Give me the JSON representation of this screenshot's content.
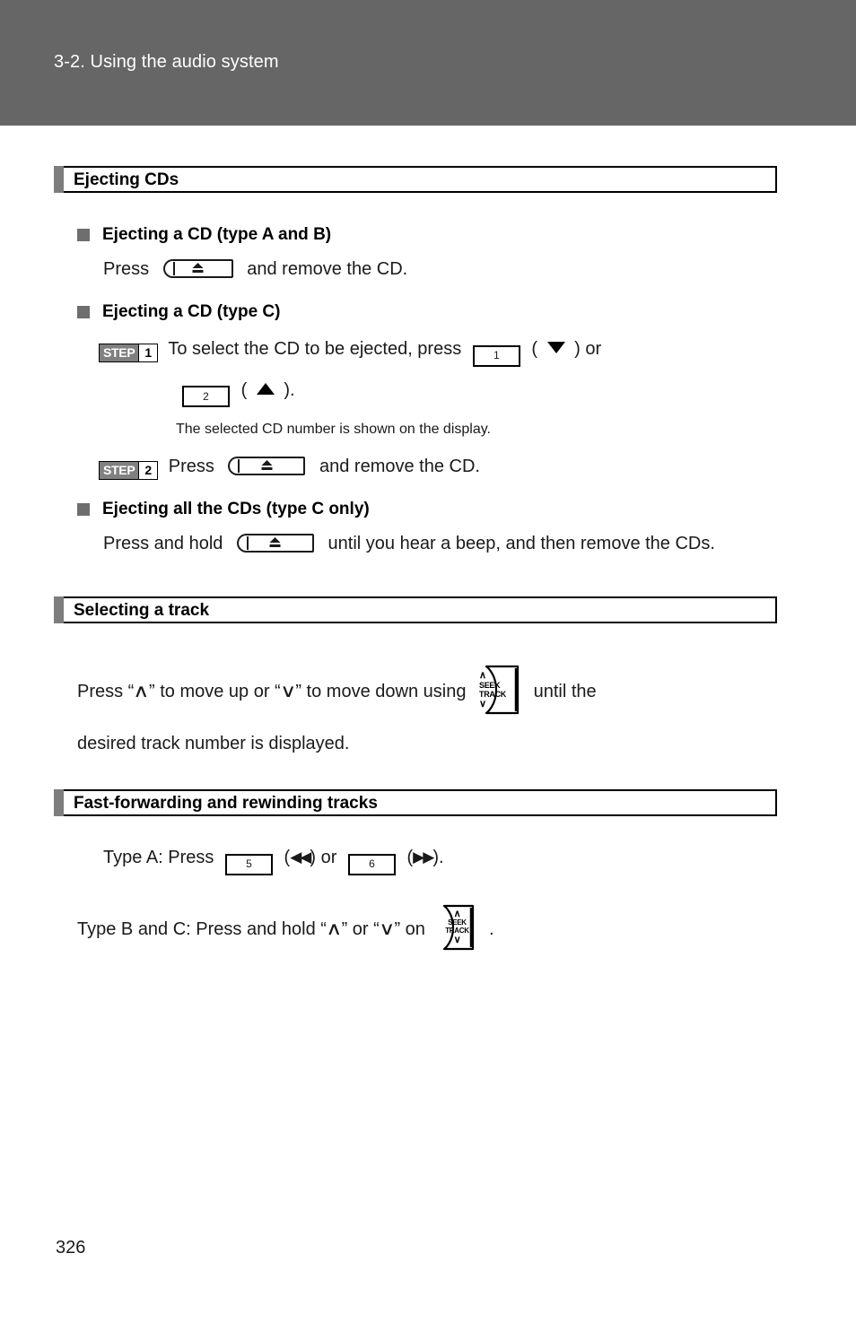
{
  "page": {
    "running_header": "3-2. Using the audio system",
    "page_number": "326",
    "header_bg": "#666666",
    "accent_gray": "#7d7d7d"
  },
  "sections": [
    {
      "id": "ejecting-cds",
      "title": "Ejecting CDs",
      "subheads": [
        {
          "id": "type-a-b",
          "title": "Ejecting a CD (type A and B)",
          "press_label": "Press",
          "after_button": "and remove the CD.",
          "button_icon": "eject-button-icon"
        },
        {
          "id": "type-c",
          "title": "Ejecting a CD (type C)",
          "steps": [
            {
              "step_word": "STEP",
              "step_number": "1",
              "text_before": "To select the CD to be ejected, press",
              "key_1": "1",
              "paren_open": "(",
              "glyph_1": "triangle-down-icon",
              "paren_close": ")",
              "conjunction": "or",
              "key_2": "2",
              "glyph_2": "triangle-up-icon",
              "trailing": ").",
              "note": "The selected CD number is shown on the display."
            },
            {
              "step_word": "STEP",
              "step_number": "2",
              "text_before": "Press",
              "button_icon": "eject-button-icon",
              "text_after": "and remove the CD."
            }
          ]
        },
        {
          "id": "all-cds-type-c",
          "title": "Ejecting all the CDs (type C only)",
          "text_before": "Press and hold",
          "button_icon": "eject-button-icon",
          "text_after": "until you hear a beep, and then remove the CDs."
        }
      ]
    },
    {
      "id": "selecting-a-track",
      "title": "Selecting a track",
      "body": {
        "part_1": "Press “",
        "chevron_up": "∧",
        "part_2": "” to move up or “",
        "chevron_down": "∨",
        "part_3": "” to move down using",
        "button_icon": "seek-track-button-icon",
        "part_4": "until the",
        "line_2": "desired track number is displayed."
      }
    },
    {
      "id": "fast-forwarding",
      "title": "Fast-forwarding and rewinding tracks",
      "body": {
        "line_a_prefix": "Type A: Press",
        "key_5": "5",
        "rewind_open": "(",
        "rewind_glyph": "◀◀",
        "rewind_close": ")",
        "or_text": "or",
        "key_6": "6",
        "forward_open": "(",
        "forward_glyph": "▶▶",
        "forward_close": ").",
        "line_b_prefix": "Type B and C: Press and hold “",
        "chevron_up": "∧",
        "line_b_mid": "” or “",
        "chevron_down": "∨",
        "line_b_suffix": "” on",
        "button_icon": "seek-track-button-icon",
        "line_b_period": "."
      }
    }
  ],
  "icons": {
    "seek_track_label_line1": "SEEK",
    "seek_track_label_line2": "TRACK",
    "seek_track_chevron_up": "∧",
    "seek_track_chevron_down": "∨"
  }
}
